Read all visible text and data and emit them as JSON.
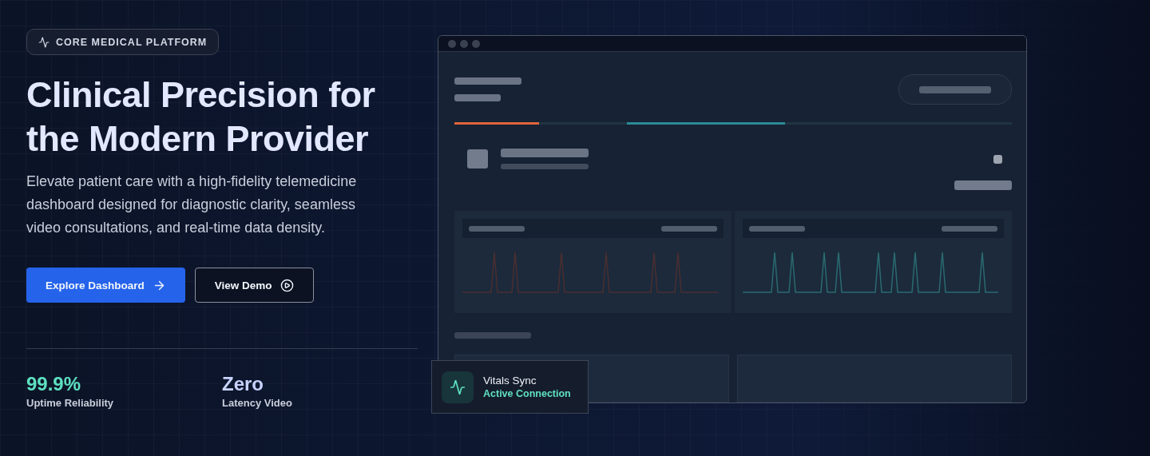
{
  "badge": {
    "label": "CORE MEDICAL PLATFORM"
  },
  "heading_lines": [
    "Clinical Precision for",
    "the Modern Provider"
  ],
  "description": "Elevate patient care with a high-fidelity telemedicine dashboard designed for diagnostic clarity, seamless video consultations, and real-time data density.",
  "buttons": [
    {
      "label": "Explore Dashboard",
      "kind": "primary"
    },
    {
      "label": "View Demo",
      "kind": "secondary"
    }
  ],
  "stats": [
    {
      "value": "99.9%",
      "label": "Uptime Reliability",
      "color": "#5ee0c0"
    },
    {
      "value": "Zero",
      "label": "Latency Video",
      "color": "#c7d2fe"
    }
  ],
  "sync_card": {
    "title": "Vitals Sync",
    "status": "Active Connection"
  }
}
